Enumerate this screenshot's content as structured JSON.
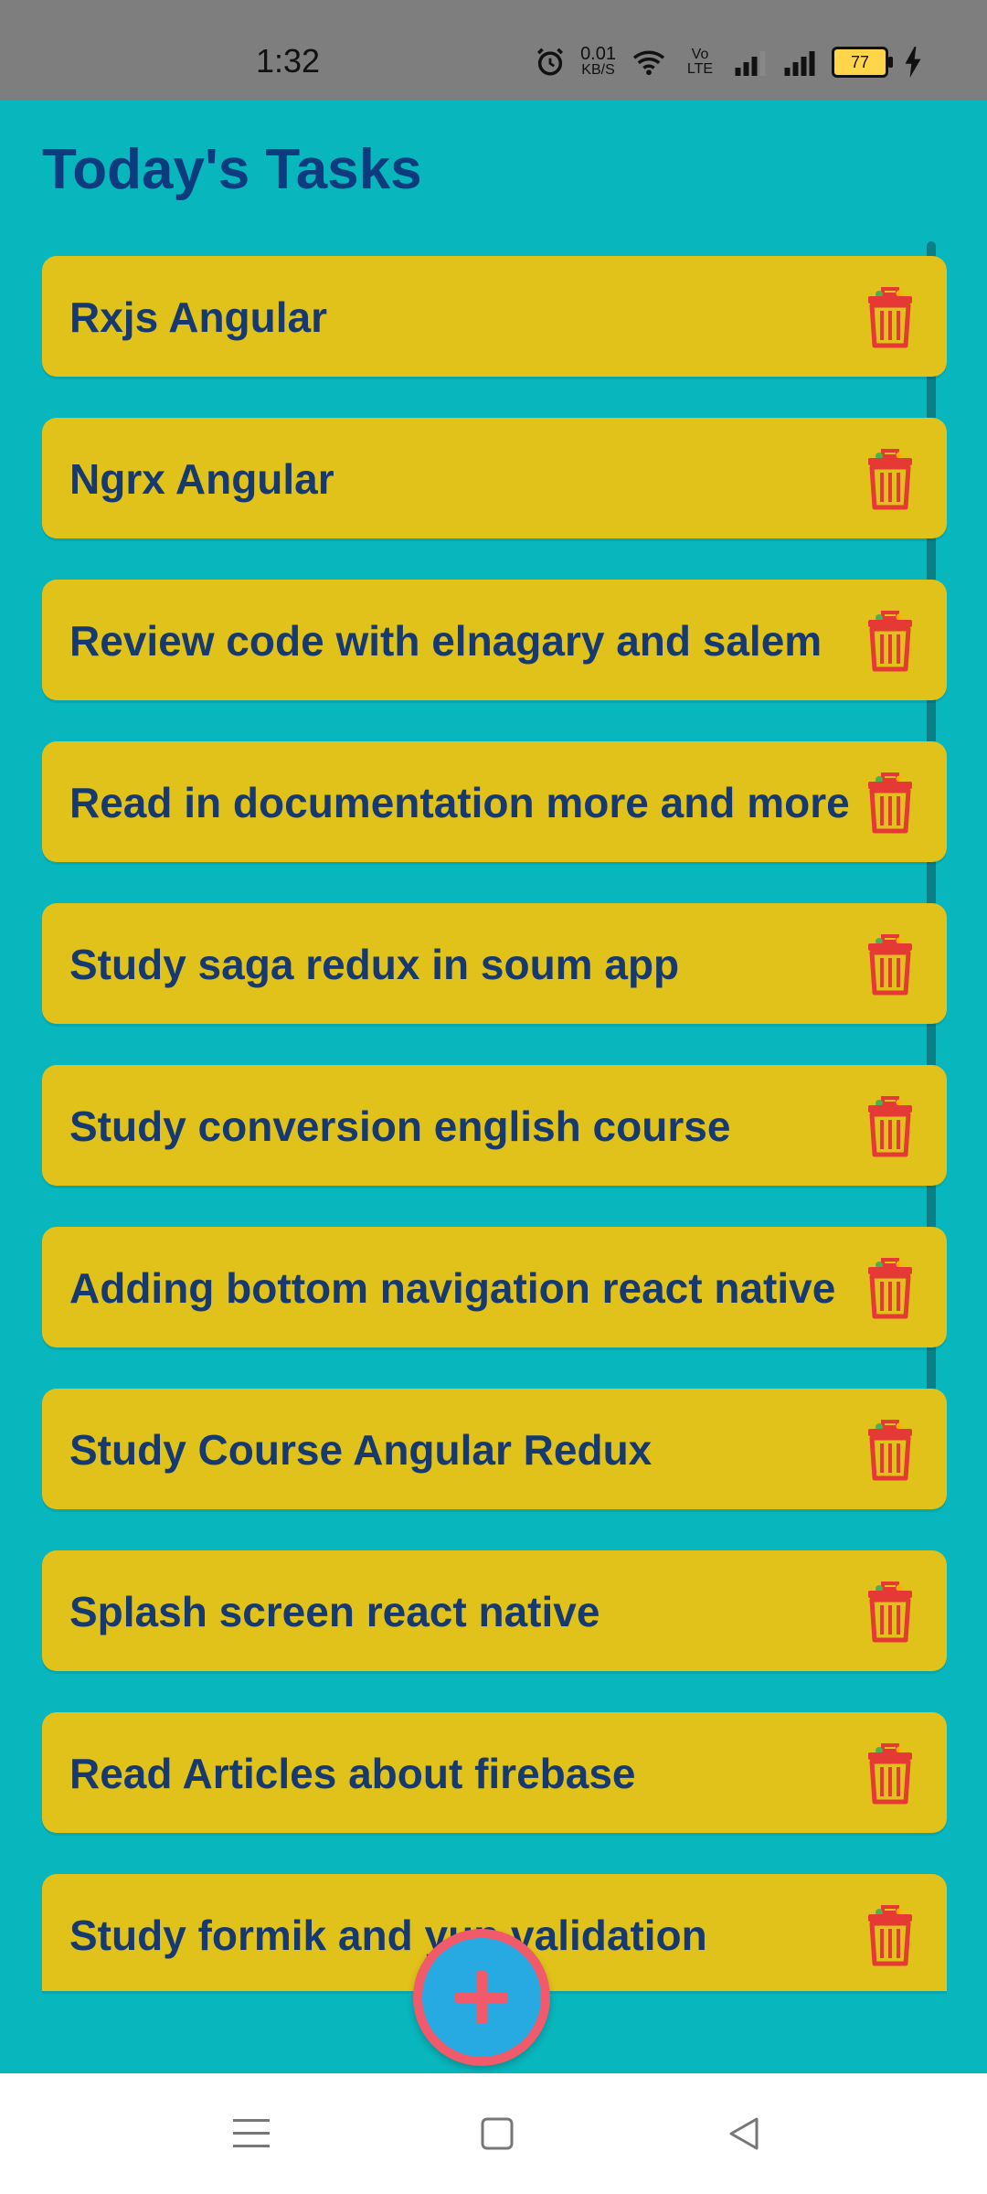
{
  "status_bar": {
    "time": "1:32",
    "net_speed_value": "0.01",
    "net_speed_unit": "KB/S",
    "volte": "Vo LTE",
    "battery": "77"
  },
  "title": "Today's Tasks",
  "tasks": [
    "Rxjs Angular",
    "Ngrx Angular",
    "Review code with elnagary and salem",
    "Read in documentation more and more",
    "Study saga redux in soum app",
    "Study conversion english course",
    "Adding bottom navigation react native",
    "Study Course Angular Redux",
    "Splash screen react native",
    "Read Articles about firebase",
    "Study formik and yup validation"
  ],
  "icons": {
    "delete": "trash-icon",
    "add": "plus-icon"
  },
  "colors": {
    "background": "#08b6bd",
    "card": "#e1c21b",
    "title": "#0c3c7d",
    "task_text": "#163a6f",
    "trash": "#e53935",
    "fab_ring": "#f05a6a",
    "fab_fill": "#27a9e1"
  }
}
